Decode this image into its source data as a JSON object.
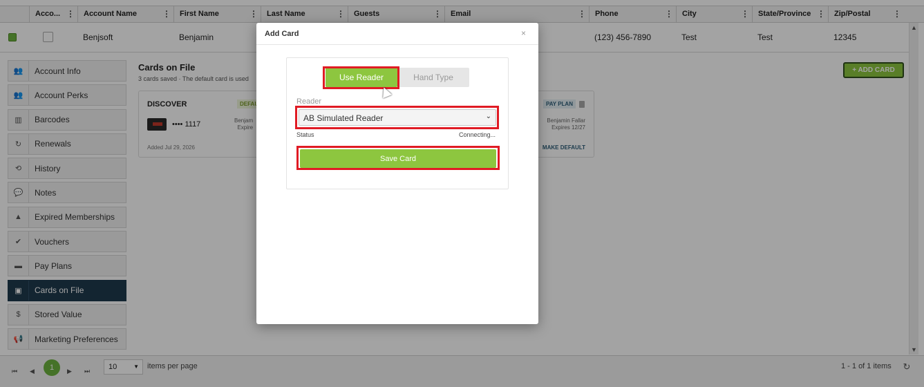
{
  "grid": {
    "columns": [
      "Acco...",
      "Account Name",
      "First Name",
      "Last Name",
      "Guests",
      "Email",
      "Phone",
      "City",
      "State/Province",
      "Zip/Postal"
    ],
    "row": {
      "account_name": "Benjsoft",
      "first_name": "Benjamin",
      "phone": "(123) 456-7890",
      "city": "Test",
      "state": "Test",
      "zip": "12345"
    }
  },
  "sidebar": {
    "items": [
      {
        "label": "Account Info",
        "icon": "users-icon",
        "glyph": "👥"
      },
      {
        "label": "Account Perks",
        "icon": "users-icon",
        "glyph": "👥"
      },
      {
        "label": "Barcodes",
        "icon": "barcode-icon",
        "glyph": "▥"
      },
      {
        "label": "Renewals",
        "icon": "renew-icon",
        "glyph": "↻"
      },
      {
        "label": "History",
        "icon": "history-icon",
        "glyph": "⟲"
      },
      {
        "label": "Notes",
        "icon": "notes-icon",
        "glyph": "💬"
      },
      {
        "label": "Expired Memberships",
        "icon": "warning-icon",
        "glyph": "▲"
      },
      {
        "label": "Vouchers",
        "icon": "check-icon",
        "glyph": "✔"
      },
      {
        "label": "Pay Plans",
        "icon": "card-icon",
        "glyph": "▬"
      },
      {
        "label": "Cards on File",
        "icon": "wallet-icon",
        "glyph": "▣",
        "active": true
      },
      {
        "label": "Stored Value",
        "icon": "dollar-icon",
        "glyph": "$"
      },
      {
        "label": "Marketing Preferences",
        "icon": "megaphone-icon",
        "glyph": "📢"
      }
    ]
  },
  "cards_on_file": {
    "title": "Cards on File",
    "subtitle": "3 cards saved · The default card is used",
    "add_button": "+ ADD CARD",
    "card1": {
      "brand": "DISCOVER",
      "badge": "DEFAU",
      "number": "•••• 1117",
      "holder": "Benjam",
      "expires": "Expire",
      "added": "Added Jul 29, 2026"
    },
    "card2": {
      "badge": "PAY PLAN",
      "holder": "Benjamin Fallar",
      "expires": "Expires 12/27",
      "action": "MAKE DEFAULT"
    }
  },
  "pager": {
    "current_page": "1",
    "page_size": "10",
    "items_per_page": "items per page",
    "info": "1 - 1 of 1 items"
  },
  "modal": {
    "title": "Add Card",
    "close": "×",
    "tab_reader": "Use Reader",
    "tab_hand": "Hand Type",
    "reader_label": "Reader",
    "reader_value": "AB Simulated Reader",
    "status_label": "Status",
    "status_value": "Connecting...",
    "save_label": "Save Card"
  },
  "colors": {
    "accent": "#8dc63f",
    "highlight": "#e01b24",
    "active_nav": "#1f3a4d"
  }
}
